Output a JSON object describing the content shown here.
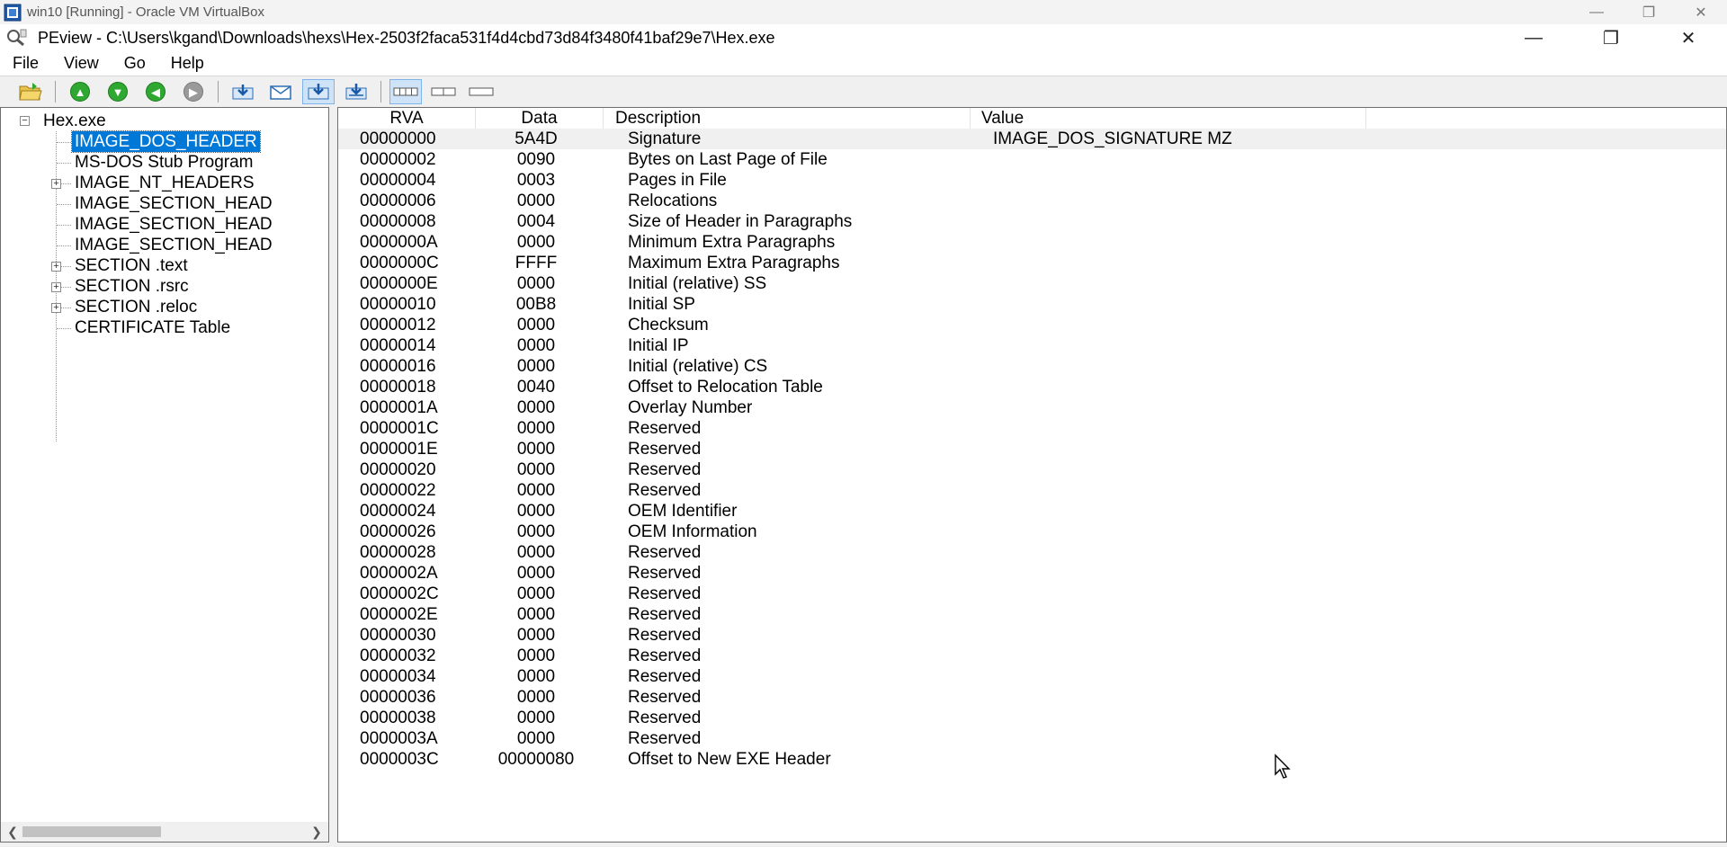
{
  "vbox": {
    "title": "win10 [Running] - Oracle VM VirtualBox",
    "controls": {
      "minimize": "—",
      "maximize": "❐",
      "close": "✕"
    }
  },
  "app": {
    "title": "PEview - C:\\Users\\kgand\\Downloads\\hexs\\Hex-2503f2faca531f4d4cbd73d84f3480f41baf29e7\\Hex.exe",
    "controls": {
      "minimize": "—",
      "maximize": "❐",
      "close": "✕"
    }
  },
  "menu": [
    "File",
    "View",
    "Go",
    "Help"
  ],
  "toolbar": {
    "buttons": [
      {
        "name": "open-file-icon"
      },
      {
        "name": "go-up-icon"
      },
      {
        "name": "go-down-icon"
      },
      {
        "name": "go-back-icon"
      },
      {
        "name": "go-forward-icon"
      },
      {
        "name": "view-address-icon"
      },
      {
        "name": "view-mail-icon"
      },
      {
        "name": "view-relative-icon",
        "pressed": true
      },
      {
        "name": "view-absolute-icon"
      },
      {
        "name": "view-bytes-icon",
        "pressed": true
      },
      {
        "name": "view-words-icon"
      },
      {
        "name": "view-dwords-icon"
      }
    ]
  },
  "tree": {
    "root": "Hex.exe",
    "items": [
      {
        "label": "IMAGE_DOS_HEADER",
        "selected": true,
        "expandable": false
      },
      {
        "label": "MS-DOS Stub Program",
        "expandable": false
      },
      {
        "label": "IMAGE_NT_HEADERS",
        "expandable": true
      },
      {
        "label": "IMAGE_SECTION_HEAD",
        "expandable": false
      },
      {
        "label": "IMAGE_SECTION_HEAD",
        "expandable": false
      },
      {
        "label": "IMAGE_SECTION_HEAD",
        "expandable": false
      },
      {
        "label": "SECTION .text",
        "expandable": true
      },
      {
        "label": "SECTION .rsrc",
        "expandable": true
      },
      {
        "label": "SECTION .reloc",
        "expandable": true
      },
      {
        "label": "CERTIFICATE Table",
        "expandable": false
      }
    ]
  },
  "table": {
    "columns": [
      "RVA",
      "Data",
      "Description",
      "Value"
    ],
    "rows": [
      {
        "rva": "00000000",
        "data": "5A4D",
        "desc": "Signature",
        "value": "IMAGE_DOS_SIGNATURE  MZ",
        "selected": true
      },
      {
        "rva": "00000002",
        "data": "0090",
        "desc": "Bytes on Last Page of File",
        "value": ""
      },
      {
        "rva": "00000004",
        "data": "0003",
        "desc": "Pages in File",
        "value": ""
      },
      {
        "rva": "00000006",
        "data": "0000",
        "desc": "Relocations",
        "value": ""
      },
      {
        "rva": "00000008",
        "data": "0004",
        "desc": "Size of Header in Paragraphs",
        "value": ""
      },
      {
        "rva": "0000000A",
        "data": "0000",
        "desc": "Minimum Extra Paragraphs",
        "value": ""
      },
      {
        "rva": "0000000C",
        "data": "FFFF",
        "desc": "Maximum Extra Paragraphs",
        "value": ""
      },
      {
        "rva": "0000000E",
        "data": "0000",
        "desc": "Initial (relative) SS",
        "value": ""
      },
      {
        "rva": "00000010",
        "data": "00B8",
        "desc": "Initial SP",
        "value": ""
      },
      {
        "rva": "00000012",
        "data": "0000",
        "desc": "Checksum",
        "value": ""
      },
      {
        "rva": "00000014",
        "data": "0000",
        "desc": "Initial IP",
        "value": ""
      },
      {
        "rva": "00000016",
        "data": "0000",
        "desc": "Initial (relative) CS",
        "value": ""
      },
      {
        "rva": "00000018",
        "data": "0040",
        "desc": "Offset to Relocation Table",
        "value": ""
      },
      {
        "rva": "0000001A",
        "data": "0000",
        "desc": "Overlay Number",
        "value": ""
      },
      {
        "rva": "0000001C",
        "data": "0000",
        "desc": "Reserved",
        "value": ""
      },
      {
        "rva": "0000001E",
        "data": "0000",
        "desc": "Reserved",
        "value": ""
      },
      {
        "rva": "00000020",
        "data": "0000",
        "desc": "Reserved",
        "value": ""
      },
      {
        "rva": "00000022",
        "data": "0000",
        "desc": "Reserved",
        "value": ""
      },
      {
        "rva": "00000024",
        "data": "0000",
        "desc": "OEM Identifier",
        "value": ""
      },
      {
        "rva": "00000026",
        "data": "0000",
        "desc": "OEM Information",
        "value": ""
      },
      {
        "rva": "00000028",
        "data": "0000",
        "desc": "Reserved",
        "value": ""
      },
      {
        "rva": "0000002A",
        "data": "0000",
        "desc": "Reserved",
        "value": ""
      },
      {
        "rva": "0000002C",
        "data": "0000",
        "desc": "Reserved",
        "value": ""
      },
      {
        "rva": "0000002E",
        "data": "0000",
        "desc": "Reserved",
        "value": ""
      },
      {
        "rva": "00000030",
        "data": "0000",
        "desc": "Reserved",
        "value": ""
      },
      {
        "rva": "00000032",
        "data": "0000",
        "desc": "Reserved",
        "value": ""
      },
      {
        "rva": "00000034",
        "data": "0000",
        "desc": "Reserved",
        "value": ""
      },
      {
        "rva": "00000036",
        "data": "0000",
        "desc": "Reserved",
        "value": ""
      },
      {
        "rva": "00000038",
        "data": "0000",
        "desc": "Reserved",
        "value": ""
      },
      {
        "rva": "0000003A",
        "data": "0000",
        "desc": "Reserved",
        "value": ""
      },
      {
        "rva": "0000003C",
        "data": "00000080",
        "desc": "Offset to New EXE Header",
        "value": ""
      }
    ]
  },
  "colors": {
    "selection": "#0078d7",
    "toolbar_bg": "#f0f0f0",
    "nav_green": "#2fa832"
  }
}
